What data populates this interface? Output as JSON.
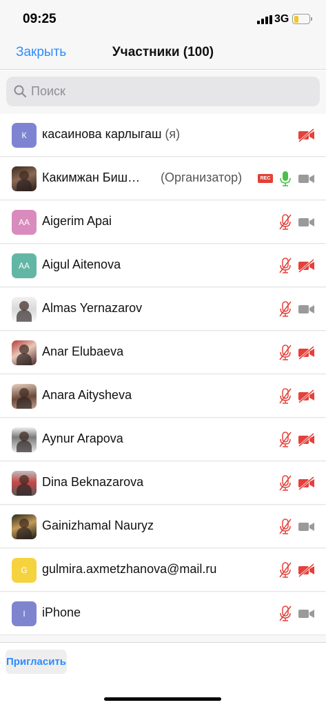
{
  "status": {
    "time": "09:25",
    "network": "3G",
    "battery_level": 0.3
  },
  "nav": {
    "close_label": "Закрыть",
    "title": "Участники (100)"
  },
  "search": {
    "placeholder": "Поиск"
  },
  "participants": [
    {
      "name": "касаинова карлыгаш",
      "suffix": " (я)",
      "avatar_initials": "К",
      "avatar": "initials",
      "audio": "none",
      "video": "off"
    },
    {
      "name": "Какимжан Биш…",
      "role": "(Организатор)",
      "recording_badge": "REC",
      "avatar": "photo",
      "audio": "on",
      "video": "on"
    },
    {
      "name": "Aigerim Apai",
      "avatar_initials": "AA",
      "avatar": "initials",
      "audio": "muted",
      "video": "on"
    },
    {
      "name": "Aigul Aitenova",
      "avatar_initials": "AA",
      "avatar": "initials",
      "audio": "muted",
      "video": "off"
    },
    {
      "name": "Almas Yernazarov",
      "avatar": "photo",
      "audio": "muted",
      "video": "on"
    },
    {
      "name": "Anar Elubaeva",
      "avatar": "photo",
      "audio": "muted",
      "video": "off"
    },
    {
      "name": "Anara Aitysheva",
      "avatar": "photo",
      "audio": "muted",
      "video": "off"
    },
    {
      "name": "Aynur Arapova",
      "avatar": "photo",
      "audio": "muted",
      "video": "off"
    },
    {
      "name": "Dina Beknazarova",
      "avatar": "photo",
      "audio": "muted",
      "video": "off"
    },
    {
      "name": "Gainizhamal Nauryz",
      "avatar": "photo",
      "audio": "muted",
      "video": "on"
    },
    {
      "name": "gulmira.axmetzhanova@mail.ru",
      "avatar_initials": "G",
      "avatar": "initials",
      "audio": "muted",
      "video": "off"
    },
    {
      "name": "iPhone",
      "avatar_initials": "I",
      "avatar": "initials",
      "audio": "muted",
      "video": "on"
    }
  ],
  "footer": {
    "invite_label": "Пригласить"
  },
  "colors": {
    "accent": "#2d8cff",
    "muted_red": "#e5403a",
    "mic_on_green": "#4cbf4a",
    "icon_gray": "#9a9a9a"
  }
}
